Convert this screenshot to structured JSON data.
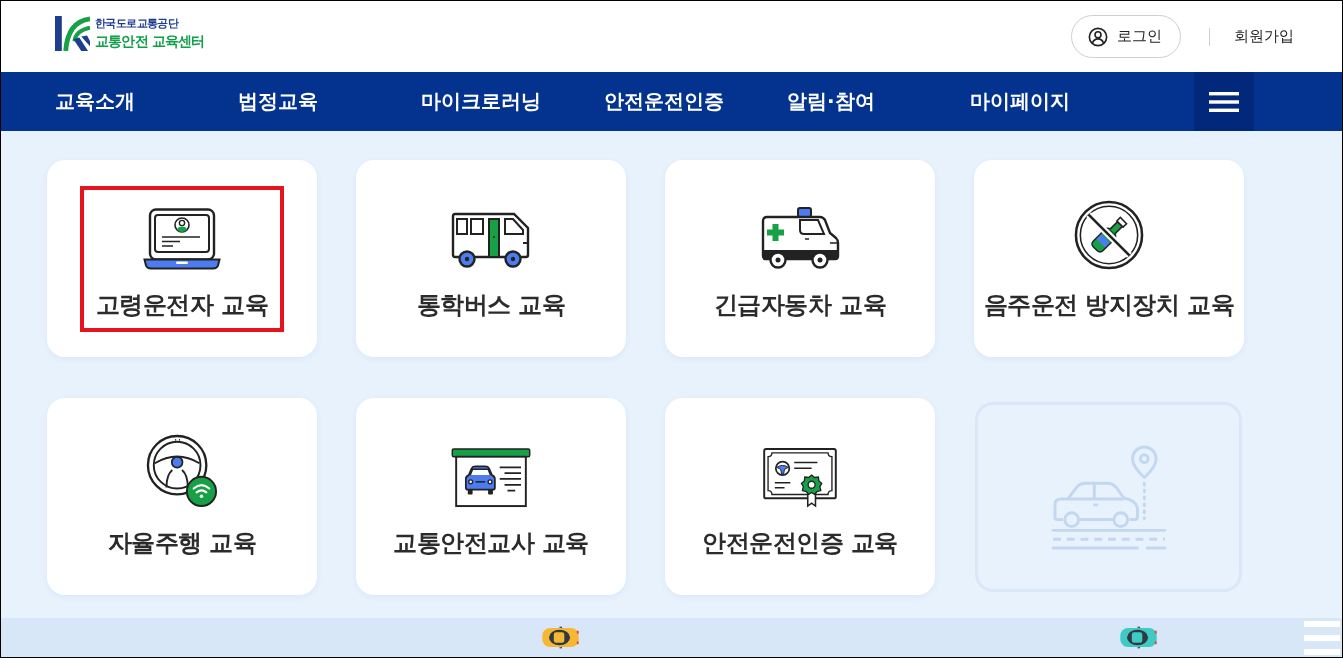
{
  "header": {
    "logo": {
      "org_name": "한국도로교통공단",
      "center_name": "교통안전 교육센터"
    },
    "login_button": "로그인",
    "signup_link": "회원가입"
  },
  "nav": {
    "items": [
      "교육소개",
      "법정교육",
      "마이크로러닝",
      "안전운전인증",
      "알림·참여",
      "마이페이지"
    ]
  },
  "cards": [
    {
      "kind": "course",
      "label": "고령운전자 교육",
      "highlighted": true
    },
    {
      "kind": "course",
      "label": "통학버스 교육",
      "highlighted": false
    },
    {
      "kind": "course",
      "label": "긴급자동차 교육",
      "highlighted": false
    },
    {
      "kind": "course",
      "label": "음주운전 방지장치 교육",
      "highlighted": false
    },
    {
      "kind": "course",
      "label": "자율주행 교육",
      "highlighted": false
    },
    {
      "kind": "course",
      "label": "교통안전교사 교육",
      "highlighted": false
    },
    {
      "kind": "course",
      "label": "안전운전인증 교육",
      "highlighted": false
    },
    {
      "kind": "placeholder",
      "highlighted": false
    }
  ]
}
